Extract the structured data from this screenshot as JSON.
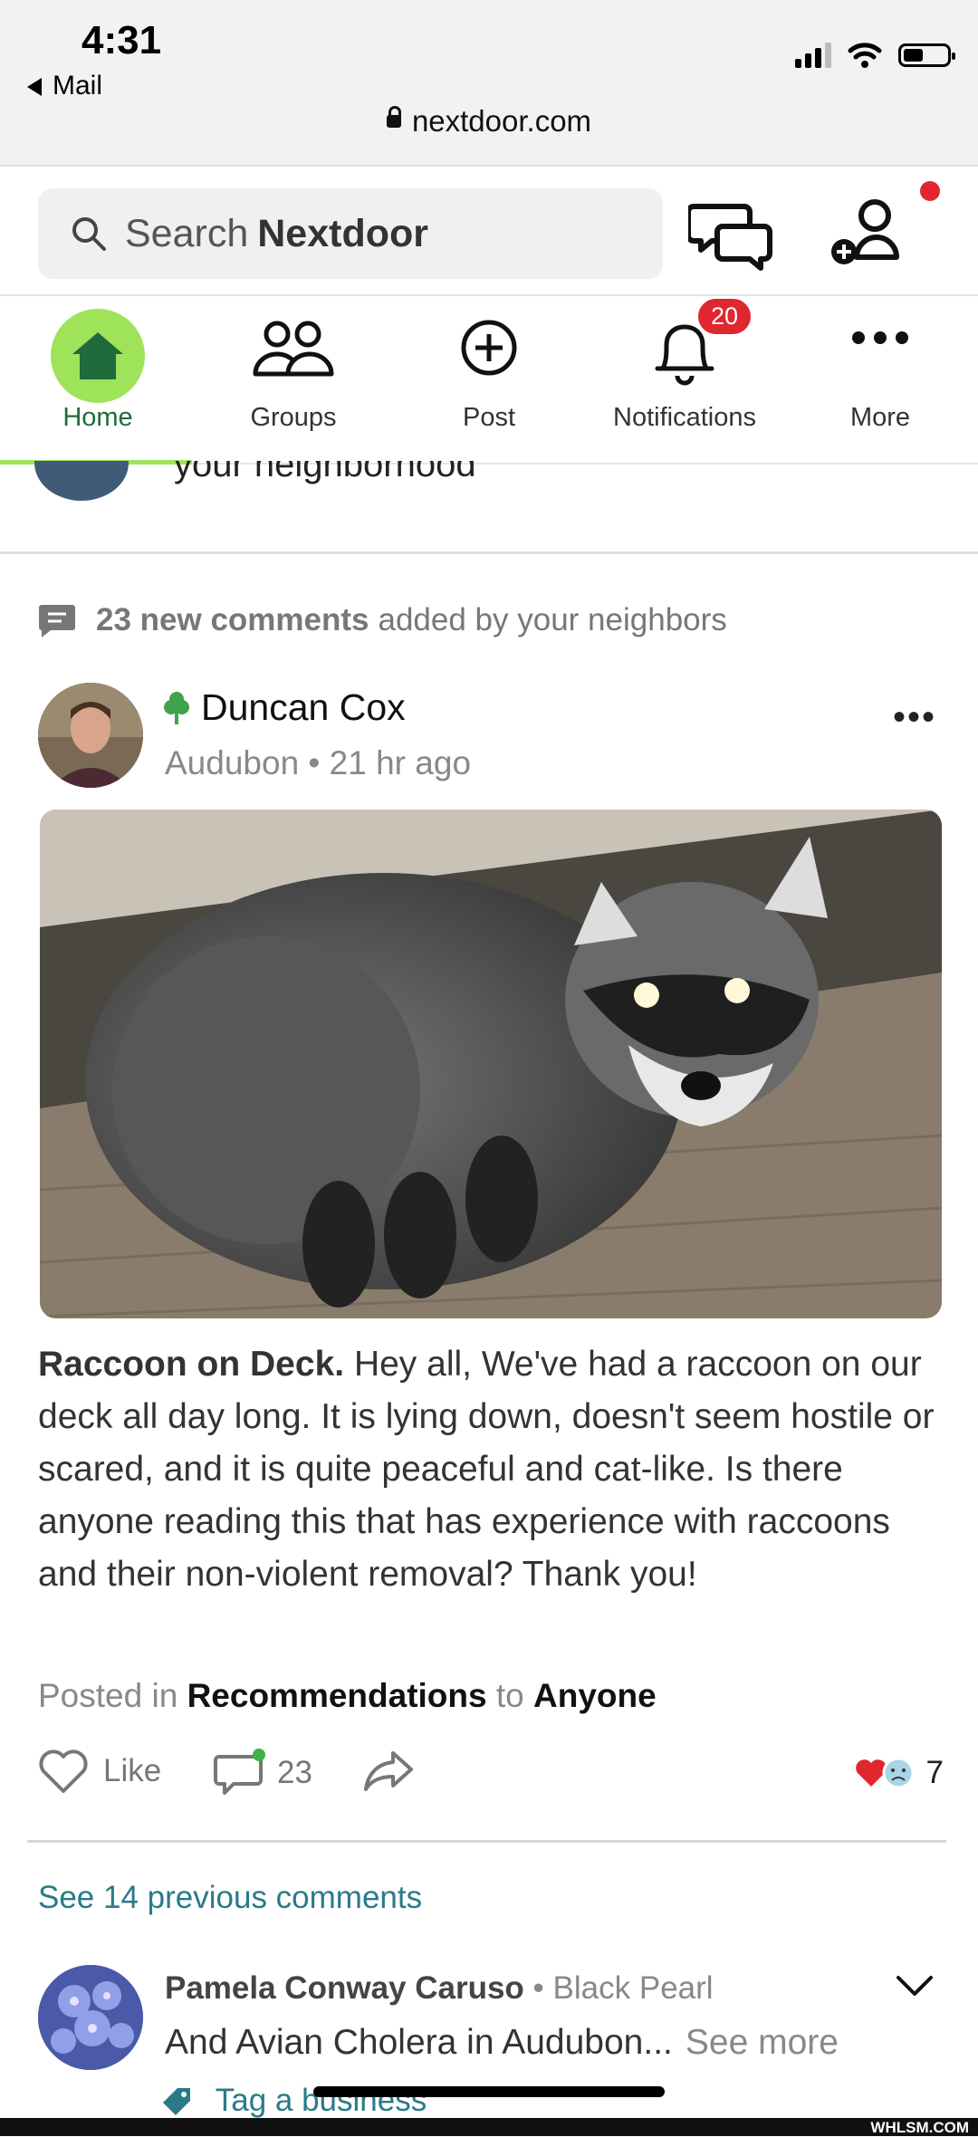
{
  "status_bar": {
    "time": "4:31",
    "back_app": "Mail",
    "url": "nextdoor.com"
  },
  "header": {
    "search_prefix": "Search",
    "search_brand": "Nextdoor"
  },
  "nav": {
    "items": [
      {
        "label": "Home",
        "active": true
      },
      {
        "label": "Groups"
      },
      {
        "label": "Post"
      },
      {
        "label": "Notifications",
        "badge": "20"
      },
      {
        "label": "More"
      }
    ]
  },
  "peek_text": "your neighborhood",
  "feed": {
    "new_comments_count": "23 new comments",
    "new_comments_suffix": "added by your neighbors",
    "post": {
      "author": "Duncan Cox",
      "neighborhood": "Audubon",
      "time": "21 hr ago",
      "title": "Raccoon on Deck.",
      "body": "Hey all, We've had a raccoon on our deck all day long.  It is lying down, doesn't seem hostile or scared, and it is quite peaceful and cat-like.  Is there anyone reading this that has experience with raccoons and their non-violent removal?  Thank you!",
      "posted_in_label": "Posted in",
      "category": "Recommendations",
      "to_label": "to",
      "audience": "Anyone",
      "like_label": "Like",
      "comment_count": "23",
      "reaction_count": "7"
    },
    "see_previous": "See 14 previous comments",
    "comment": {
      "author": "Pamela Conway Caruso",
      "separator": "•",
      "neighborhood": "Black Pearl",
      "text": "And Avian Cholera in Audubon...",
      "see_more": "See more",
      "tag_business": "Tag a business"
    }
  },
  "watermark": "WHLSM.COM",
  "colors": {
    "brand_green": "#9ee35a",
    "badge_red": "#e0262f",
    "link_teal": "#2a7a8a"
  }
}
